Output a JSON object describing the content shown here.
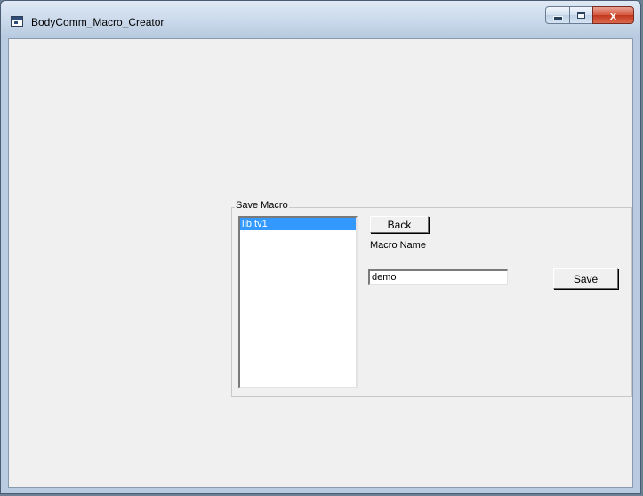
{
  "window": {
    "title": "BodyComm_Macro_Creator",
    "close_glyph": "x"
  },
  "save_macro": {
    "group_label": "Save Macro",
    "macros": [
      {
        "name": "lib.tv1",
        "selected": true
      }
    ],
    "back_label": "Back",
    "macro_name_label": "Macro Name",
    "macro_name_value": "demo",
    "save_label": "Save"
  },
  "colors": {
    "selection": "#3399ff",
    "client_background": "#f0f0f0",
    "close_button": "#c2371c"
  }
}
